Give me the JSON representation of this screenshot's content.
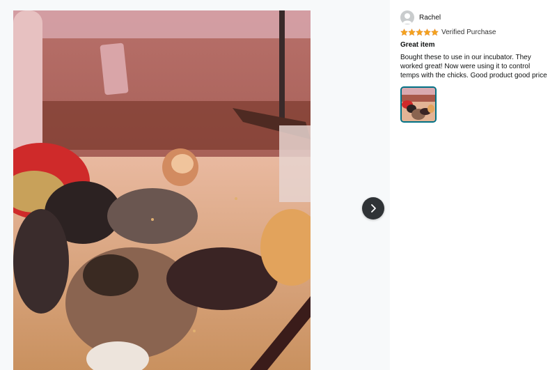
{
  "review": {
    "username": "Rachel",
    "rating": 5,
    "rating_max": 5,
    "verified_label": "Verified Purchase",
    "title": "Great item",
    "body": "Bought these to use in our incubator. They worked great! Now were using it to control temps with the chicks. Good product good price"
  },
  "colors": {
    "star": "#f4a41c",
    "next_button_bg": "#2f3336",
    "thumb_border": "#007185"
  },
  "icons": {
    "next": "chevron-right-icon",
    "avatar": "user-avatar-icon",
    "star": "star-icon"
  }
}
